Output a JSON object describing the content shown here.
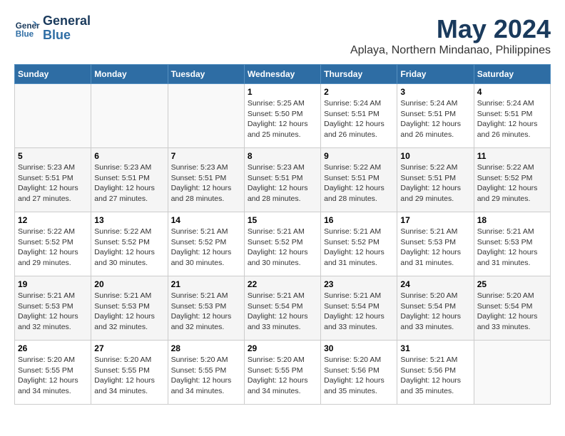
{
  "header": {
    "logo_line1": "General",
    "logo_line2": "Blue",
    "month": "May 2024",
    "location": "Aplaya, Northern Mindanao, Philippines"
  },
  "weekdays": [
    "Sunday",
    "Monday",
    "Tuesday",
    "Wednesday",
    "Thursday",
    "Friday",
    "Saturday"
  ],
  "weeks": [
    [
      {
        "day": "",
        "info": ""
      },
      {
        "day": "",
        "info": ""
      },
      {
        "day": "",
        "info": ""
      },
      {
        "day": "1",
        "info": "Sunrise: 5:25 AM\nSunset: 5:50 PM\nDaylight: 12 hours\nand 25 minutes."
      },
      {
        "day": "2",
        "info": "Sunrise: 5:24 AM\nSunset: 5:51 PM\nDaylight: 12 hours\nand 26 minutes."
      },
      {
        "day": "3",
        "info": "Sunrise: 5:24 AM\nSunset: 5:51 PM\nDaylight: 12 hours\nand 26 minutes."
      },
      {
        "day": "4",
        "info": "Sunrise: 5:24 AM\nSunset: 5:51 PM\nDaylight: 12 hours\nand 26 minutes."
      }
    ],
    [
      {
        "day": "5",
        "info": "Sunrise: 5:23 AM\nSunset: 5:51 PM\nDaylight: 12 hours\nand 27 minutes."
      },
      {
        "day": "6",
        "info": "Sunrise: 5:23 AM\nSunset: 5:51 PM\nDaylight: 12 hours\nand 27 minutes."
      },
      {
        "day": "7",
        "info": "Sunrise: 5:23 AM\nSunset: 5:51 PM\nDaylight: 12 hours\nand 28 minutes."
      },
      {
        "day": "8",
        "info": "Sunrise: 5:23 AM\nSunset: 5:51 PM\nDaylight: 12 hours\nand 28 minutes."
      },
      {
        "day": "9",
        "info": "Sunrise: 5:22 AM\nSunset: 5:51 PM\nDaylight: 12 hours\nand 28 minutes."
      },
      {
        "day": "10",
        "info": "Sunrise: 5:22 AM\nSunset: 5:51 PM\nDaylight: 12 hours\nand 29 minutes."
      },
      {
        "day": "11",
        "info": "Sunrise: 5:22 AM\nSunset: 5:52 PM\nDaylight: 12 hours\nand 29 minutes."
      }
    ],
    [
      {
        "day": "12",
        "info": "Sunrise: 5:22 AM\nSunset: 5:52 PM\nDaylight: 12 hours\nand 29 minutes."
      },
      {
        "day": "13",
        "info": "Sunrise: 5:22 AM\nSunset: 5:52 PM\nDaylight: 12 hours\nand 30 minutes."
      },
      {
        "day": "14",
        "info": "Sunrise: 5:21 AM\nSunset: 5:52 PM\nDaylight: 12 hours\nand 30 minutes."
      },
      {
        "day": "15",
        "info": "Sunrise: 5:21 AM\nSunset: 5:52 PM\nDaylight: 12 hours\nand 30 minutes."
      },
      {
        "day": "16",
        "info": "Sunrise: 5:21 AM\nSunset: 5:52 PM\nDaylight: 12 hours\nand 31 minutes."
      },
      {
        "day": "17",
        "info": "Sunrise: 5:21 AM\nSunset: 5:53 PM\nDaylight: 12 hours\nand 31 minutes."
      },
      {
        "day": "18",
        "info": "Sunrise: 5:21 AM\nSunset: 5:53 PM\nDaylight: 12 hours\nand 31 minutes."
      }
    ],
    [
      {
        "day": "19",
        "info": "Sunrise: 5:21 AM\nSunset: 5:53 PM\nDaylight: 12 hours\nand 32 minutes."
      },
      {
        "day": "20",
        "info": "Sunrise: 5:21 AM\nSunset: 5:53 PM\nDaylight: 12 hours\nand 32 minutes."
      },
      {
        "day": "21",
        "info": "Sunrise: 5:21 AM\nSunset: 5:53 PM\nDaylight: 12 hours\nand 32 minutes."
      },
      {
        "day": "22",
        "info": "Sunrise: 5:21 AM\nSunset: 5:54 PM\nDaylight: 12 hours\nand 33 minutes."
      },
      {
        "day": "23",
        "info": "Sunrise: 5:21 AM\nSunset: 5:54 PM\nDaylight: 12 hours\nand 33 minutes."
      },
      {
        "day": "24",
        "info": "Sunrise: 5:20 AM\nSunset: 5:54 PM\nDaylight: 12 hours\nand 33 minutes."
      },
      {
        "day": "25",
        "info": "Sunrise: 5:20 AM\nSunset: 5:54 PM\nDaylight: 12 hours\nand 33 minutes."
      }
    ],
    [
      {
        "day": "26",
        "info": "Sunrise: 5:20 AM\nSunset: 5:55 PM\nDaylight: 12 hours\nand 34 minutes."
      },
      {
        "day": "27",
        "info": "Sunrise: 5:20 AM\nSunset: 5:55 PM\nDaylight: 12 hours\nand 34 minutes."
      },
      {
        "day": "28",
        "info": "Sunrise: 5:20 AM\nSunset: 5:55 PM\nDaylight: 12 hours\nand 34 minutes."
      },
      {
        "day": "29",
        "info": "Sunrise: 5:20 AM\nSunset: 5:55 PM\nDaylight: 12 hours\nand 34 minutes."
      },
      {
        "day": "30",
        "info": "Sunrise: 5:20 AM\nSunset: 5:56 PM\nDaylight: 12 hours\nand 35 minutes."
      },
      {
        "day": "31",
        "info": "Sunrise: 5:21 AM\nSunset: 5:56 PM\nDaylight: 12 hours\nand 35 minutes."
      },
      {
        "day": "",
        "info": ""
      }
    ]
  ]
}
